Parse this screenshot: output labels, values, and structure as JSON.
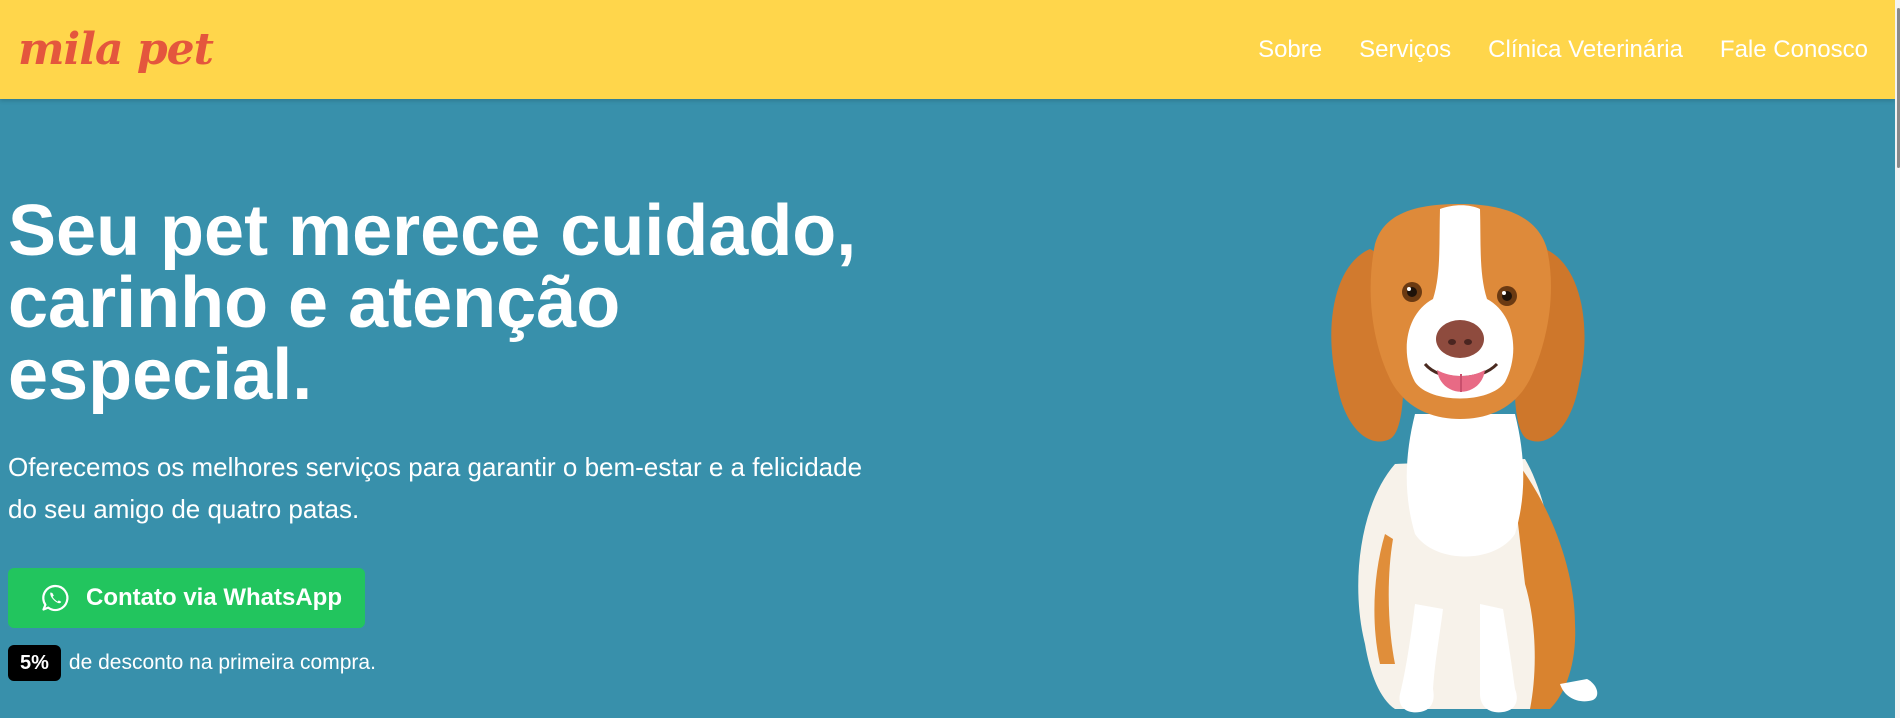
{
  "header": {
    "logo": "mila pet",
    "nav": [
      "Sobre",
      "Serviços",
      "Clínica Veterinária",
      "Fale Conosco"
    ]
  },
  "hero": {
    "title_lines": [
      "Seu pet merece cuidado,",
      "carinho e atenção",
      "especial."
    ],
    "subtitle_lines": [
      "Oferecemos os melhores serviços para garantir o bem-estar e a felicidade",
      "do seu amigo de quatro patas."
    ],
    "cta_label": "Contato via WhatsApp",
    "discount_badge": "5%",
    "discount_text": "de desconto na primeira compra."
  },
  "colors": {
    "header_bg": "#FFD64B",
    "logo": "#E4563D",
    "hero_bg": "#3890AB",
    "cta_bg": "#22C55E",
    "badge_bg": "#000000"
  },
  "icons": [
    "whatsapp-icon"
  ]
}
